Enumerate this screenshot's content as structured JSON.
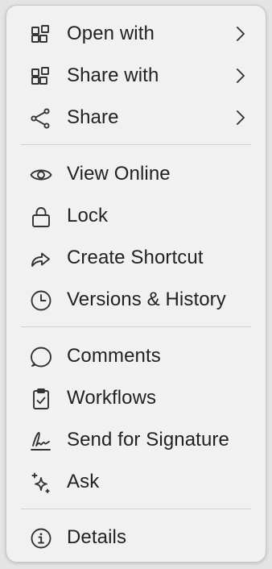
{
  "menu": {
    "groups": [
      {
        "items": [
          {
            "label": "Open with",
            "icon": "apps-icon",
            "has_submenu": true
          },
          {
            "label": "Share with",
            "icon": "apps-icon",
            "has_submenu": true
          },
          {
            "label": "Share",
            "icon": "share-icon",
            "has_submenu": true
          }
        ]
      },
      {
        "items": [
          {
            "label": "View Online",
            "icon": "eye-icon",
            "has_submenu": false
          },
          {
            "label": "Lock",
            "icon": "lock-icon",
            "has_submenu": false
          },
          {
            "label": "Create Shortcut",
            "icon": "shortcut-arrow-icon",
            "has_submenu": false
          },
          {
            "label": "Versions & History",
            "icon": "clock-icon",
            "has_submenu": false
          }
        ]
      },
      {
        "items": [
          {
            "label": "Comments",
            "icon": "comment-icon",
            "has_submenu": false
          },
          {
            "label": "Workflows",
            "icon": "clipboard-check-icon",
            "has_submenu": false
          },
          {
            "label": "Send for Signature",
            "icon": "signature-icon",
            "has_submenu": false
          },
          {
            "label": "Ask",
            "icon": "sparkle-icon",
            "has_submenu": false
          }
        ]
      },
      {
        "items": [
          {
            "label": "Details",
            "icon": "info-icon",
            "has_submenu": false
          }
        ]
      }
    ]
  }
}
